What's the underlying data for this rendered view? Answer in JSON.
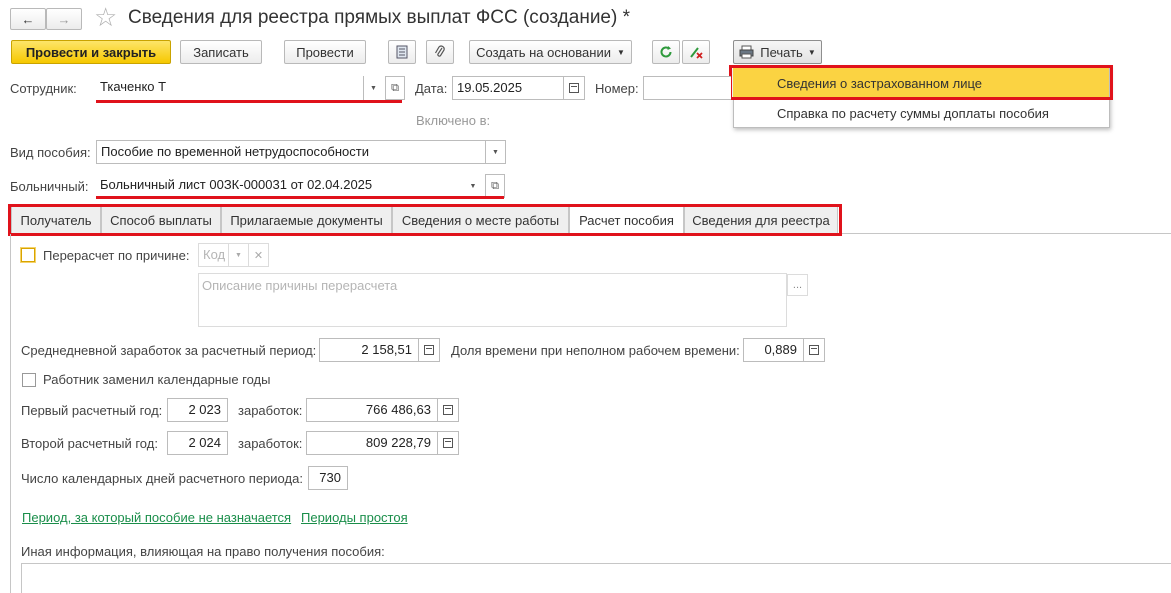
{
  "header": {
    "title": "Сведения для реестра прямых выплат ФСС (создание) *",
    "back_glyph": "←",
    "forward_glyph": "→",
    "star_glyph": "☆"
  },
  "toolbar": {
    "post_close": "Провести и закрыть",
    "write": "Записать",
    "post": "Провести",
    "create_based": "Создать на основании",
    "print": "Печать"
  },
  "print_menu": {
    "items": [
      "Сведения о застрахованном лице",
      "Справка по расчету суммы доплаты пособия"
    ]
  },
  "form": {
    "employee_label": "Сотрудник:",
    "employee_value": "Ткаченко Т",
    "date_label": "Дата:",
    "date_value": "19.05.2025",
    "number_label": "Номер:",
    "included_label": "Включено в:",
    "benefit_type_label": "Вид пособия:",
    "benefit_type_value": "Пособие по временной нетрудоспособности",
    "sick_leave_label": "Больничный:",
    "sick_leave_value": "Больничный лист 00ЗК-000031 от 02.04.2025"
  },
  "tabs": [
    "Получатель",
    "Способ выплаты",
    "Прилагаемые документы",
    "Сведения о месте работы",
    "Расчет пособия",
    "Сведения для реестра"
  ],
  "calc": {
    "recalc_label": "Перерасчет по причине:",
    "code_placeholder": "Код",
    "reason_placeholder": "Описание причины перерасчета",
    "avg_label": "Среднедневной заработок за расчетный период:",
    "avg_value": "2 158,51",
    "share_label": "Доля времени при неполном рабочем времени:",
    "share_value": "0,889",
    "replaced_years_label": "Работник заменил календарные годы",
    "year1_label": "Первый расчетный год:",
    "year1_value": "2 023",
    "earn_label": "заработок:",
    "earn1_value": "766 486,63",
    "year2_label": "Второй расчетный год:",
    "year2_value": "2 024",
    "earn2_value": "809 228,79",
    "days_label": "Число календарных дней расчетного периода:",
    "days_value": "730",
    "link_period": "Период, за который пособие не назначается",
    "link_idle": "Периоды простоя",
    "other_info_label": "Иная информация, влияющая на право получения пособия:"
  },
  "colors": {
    "primary_button": "#f6c800",
    "highlight": "#e0121b",
    "menu_selected": "#fbd342",
    "link": "#1a8e4a"
  }
}
